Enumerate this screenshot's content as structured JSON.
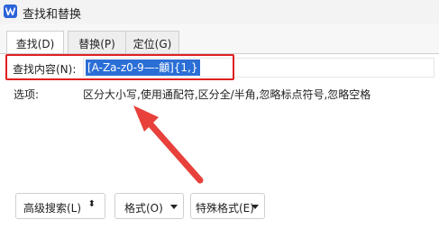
{
  "window": {
    "title": "查找和替换"
  },
  "tabs": [
    {
      "label": "查找(D)",
      "active": true
    },
    {
      "label": "替换(P)",
      "active": false
    },
    {
      "label": "定位(G)",
      "active": false
    }
  ],
  "find": {
    "label": "查找内容(N):",
    "value": "[A-Za-z0-9—-龥]{1,}"
  },
  "options": {
    "label": "选项:",
    "text": "区分大小写,使用通配符,区分全/半角,忽略标点符号,忽略空格"
  },
  "buttons": {
    "advanced_search": "高级搜索(L)",
    "format": "格式(O)",
    "special_format": "特殊格式(E)"
  },
  "colors": {
    "highlight": "#e02020",
    "selection": "#2b6fd6",
    "app_icon": "#2b63d9"
  }
}
